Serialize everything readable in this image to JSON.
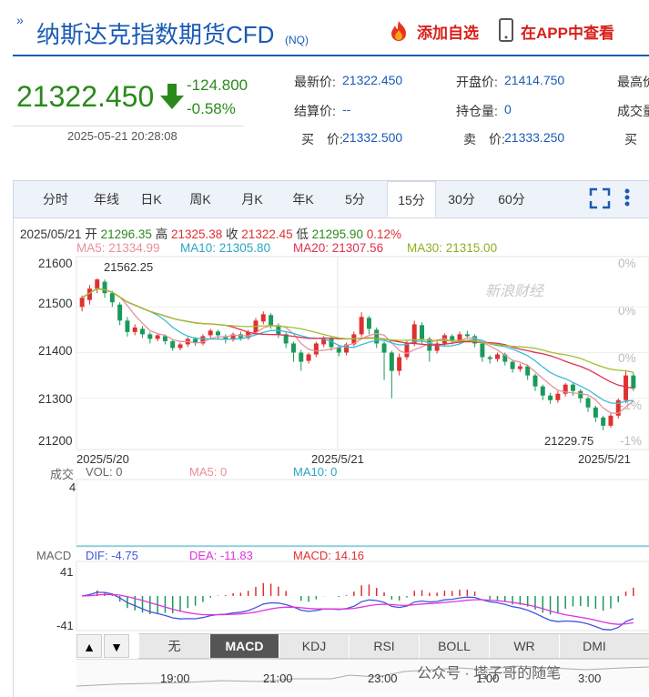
{
  "header": {
    "title": "纳斯达克指数期货CFD",
    "subtitle": "(NQ)",
    "add_watch": "添加自选",
    "view_app": "在APP中查看"
  },
  "quote": {
    "price": "21322.450",
    "change": "-124.800",
    "change_pct": "-0.58%",
    "time": "2025-05-21 20:28:08",
    "fields": {
      "latest_label": "最新价:",
      "latest_value": "21322.450",
      "open_label": "开盘价:",
      "open_value": "21414.750",
      "high_label": "最高价",
      "settle_label": "结算价:",
      "settle_value": "--",
      "oi_label": "持仓量:",
      "oi_value": "0",
      "volume_label": "成交量",
      "bid_label": "买　价:",
      "bid_value": "21332.500",
      "ask_label": "卖　价:",
      "ask_value": "21333.250",
      "bidq_label": "买　量"
    }
  },
  "tabs": [
    "分时",
    "年线",
    "日K",
    "周K",
    "月K",
    "年K",
    "5分",
    "15分",
    "30分",
    "60分"
  ],
  "active_tab": "15分",
  "ohlc": {
    "date": "2025/05/21",
    "open_label": "开",
    "open": "21296.35",
    "high_label": "高",
    "high": "21325.38",
    "close_label": "收",
    "close": "21322.45",
    "low_label": "低",
    "low": "21295.90",
    "pct": "0.12%"
  },
  "ma_legend": {
    "ma5": "MA5: 21334.99",
    "ma10": "MA10: 21305.80",
    "ma20": "MA20: 21307.56",
    "ma30": "MA30: 21315.00"
  },
  "colors": {
    "up": "#e03030",
    "down": "#1a9a5a",
    "ma5": "#e8909a",
    "ma10": "#3bbbd6",
    "ma20": "#e03050",
    "ma30": "#a0c030",
    "dif": "#4455dd",
    "dea": "#dd33dd",
    "brand": "#1a5bb5"
  },
  "watermark": "新浪财经",
  "vol_panel": {
    "title": "成交",
    "vol": "VOL: 0",
    "ma5": "MA5: 0",
    "ma10": "MA10: 0",
    "y_top": "4"
  },
  "macd_panel": {
    "title": "MACD",
    "dif": "DIF: -4.75",
    "dea": "DEA: -11.83",
    "macd": "MACD: 14.16",
    "y_top": "41",
    "y_bottom": "-41"
  },
  "indicators": [
    "无",
    "MACD",
    "KDJ",
    "RSI",
    "BOLL",
    "WR",
    "DMI"
  ],
  "active_indicator": "MACD",
  "nav_times": [
    "19:00",
    "21:00",
    "23:00",
    "1:00",
    "3:00"
  ],
  "overlay_text": "公众号 · 塔子哥的随笔",
  "chart_data": {
    "type": "candlestick",
    "y_ticks": [
      21600,
      21500,
      21400,
      21300,
      21200
    ],
    "ylim": [
      21192,
      21610
    ],
    "pct_ticks": [
      "0%",
      "0%",
      "0%",
      "-1%",
      "-1%"
    ],
    "x_labels": [
      "2025/5/20",
      "2025/5/21",
      "2025/5/21"
    ],
    "annotations": {
      "max": "21562.25",
      "min": "21229.75"
    },
    "candles": [
      [
        21500,
        21520,
        21490,
        21525
      ],
      [
        21515,
        21540,
        21505,
        21548
      ],
      [
        21540,
        21560,
        21530,
        21562
      ],
      [
        21555,
        21530,
        21520,
        21560
      ],
      [
        21530,
        21510,
        21500,
        21535
      ],
      [
        21505,
        21470,
        21460,
        21510
      ],
      [
        21470,
        21445,
        21435,
        21478
      ],
      [
        21445,
        21455,
        21438,
        21462
      ],
      [
        21452,
        21440,
        21432,
        21458
      ],
      [
        21440,
        21430,
        21420,
        21445
      ],
      [
        21430,
        21438,
        21425,
        21442
      ],
      [
        21436,
        21425,
        21418,
        21440
      ],
      [
        21425,
        21410,
        21404,
        21428
      ],
      [
        21410,
        21418,
        21405,
        21422
      ],
      [
        21418,
        21430,
        21412,
        21434
      ],
      [
        21430,
        21422,
        21415,
        21434
      ],
      [
        21420,
        21436,
        21416,
        21440
      ],
      [
        21438,
        21448,
        21432,
        21452
      ],
      [
        21446,
        21438,
        21430,
        21450
      ],
      [
        21436,
        21428,
        21420,
        21440
      ],
      [
        21428,
        21440,
        21424,
        21444
      ],
      [
        21440,
        21432,
        21426,
        21446
      ],
      [
        21432,
        21445,
        21428,
        21450
      ],
      [
        21444,
        21470,
        21440,
        21476
      ],
      [
        21468,
        21484,
        21462,
        21490
      ],
      [
        21482,
        21460,
        21452,
        21486
      ],
      [
        21460,
        21440,
        21432,
        21464
      ],
      [
        21440,
        21420,
        21410,
        21444
      ],
      [
        21420,
        21400,
        21380,
        21424
      ],
      [
        21400,
        21380,
        21360,
        21406
      ],
      [
        21382,
        21396,
        21376,
        21400
      ],
      [
        21396,
        21420,
        21390,
        21424
      ],
      [
        21418,
        21430,
        21412,
        21436
      ],
      [
        21430,
        21412,
        21404,
        21434
      ],
      [
        21412,
        21400,
        21392,
        21416
      ],
      [
        21400,
        21418,
        21394,
        21422
      ],
      [
        21418,
        21440,
        21414,
        21446
      ],
      [
        21440,
        21478,
        21434,
        21488
      ],
      [
        21476,
        21452,
        21440,
        21480
      ],
      [
        21450,
        21420,
        21410,
        21455
      ],
      [
        21420,
        21400,
        21340,
        21425
      ],
      [
        21400,
        21360,
        21300,
        21404
      ],
      [
        21360,
        21390,
        21350,
        21398
      ],
      [
        21390,
        21420,
        21384,
        21426
      ],
      [
        21420,
        21462,
        21414,
        21470
      ],
      [
        21460,
        21430,
        21420,
        21466
      ],
      [
        21430,
        21404,
        21380,
        21434
      ],
      [
        21404,
        21420,
        21398,
        21426
      ],
      [
        21420,
        21438,
        21414,
        21442
      ],
      [
        21436,
        21426,
        21418,
        21440
      ],
      [
        21426,
        21440,
        21420,
        21446
      ],
      [
        21440,
        21436,
        21430,
        21448
      ],
      [
        21436,
        21420,
        21412,
        21440
      ],
      [
        21420,
        21390,
        21380,
        21424
      ],
      [
        21390,
        21386,
        21376,
        21394
      ],
      [
        21386,
        21396,
        21380,
        21400
      ],
      [
        21396,
        21380,
        21372,
        21400
      ],
      [
        21380,
        21364,
        21356,
        21384
      ],
      [
        21364,
        21370,
        21358,
        21376
      ],
      [
        21370,
        21350,
        21340,
        21374
      ],
      [
        21350,
        21326,
        21316,
        21354
      ],
      [
        21326,
        21306,
        21296,
        21330
      ],
      [
        21306,
        21296,
        21288,
        21312
      ],
      [
        21296,
        21310,
        21290,
        21316
      ],
      [
        21310,
        21330,
        21304,
        21334
      ],
      [
        21330,
        21316,
        21306,
        21334
      ],
      [
        21316,
        21300,
        21290,
        21320
      ],
      [
        21300,
        21280,
        21270,
        21304
      ],
      [
        21280,
        21258,
        21248,
        21284
      ],
      [
        21258,
        21240,
        21230,
        21262
      ],
      [
        21240,
        21262,
        21236,
        21268
      ],
      [
        21262,
        21296,
        21256,
        21300
      ],
      [
        21296,
        21350,
        21290,
        21362
      ],
      [
        21350,
        21322,
        21316,
        21356
      ]
    ],
    "vol_note": "VOL: 0"
  }
}
